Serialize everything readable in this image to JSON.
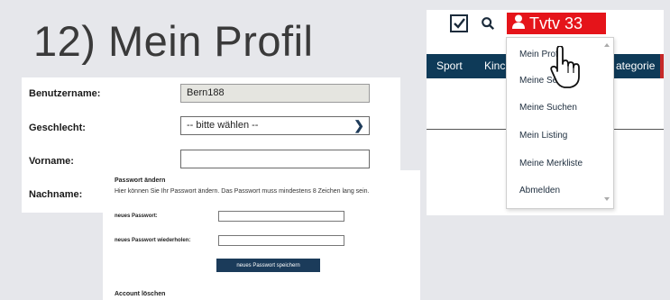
{
  "slide": {
    "title": "12) Mein Profil"
  },
  "profile_form": {
    "username_label": "Benutzername:",
    "username_value": "Bern188",
    "gender_label": "Geschlecht:",
    "gender_value": "-- bitte wählen --",
    "firstname_label": "Vorname:",
    "firstname_value": "",
    "lastname_label": "Nachname:"
  },
  "password_section": {
    "heading": "Passwort ändern",
    "description": "Hier können Sie Ihr Passwort ändern. Das Passwort muss mindestens 8 Zeichen lang sein.",
    "new_password_label": "neues Passwort:",
    "repeat_password_label": "neues Passwort wiederholen:",
    "save_button": "neues Passwort speichern",
    "delete_heading": "Account löschen"
  },
  "header": {
    "user_name": "Tvtv 33",
    "nav_items": [
      "Sport",
      "Kinc",
      "ategorie"
    ],
    "icons": [
      "checklist-icon",
      "search-icon",
      "user-icon"
    ],
    "accent_color": "#e5141a",
    "nav_color": "#0e3a58"
  },
  "user_menu": {
    "items": [
      "Mein Profil",
      "Meine Sen",
      "Meine Suchen",
      "Mein Listing",
      "Meine Merkliste",
      "Abmelden"
    ]
  }
}
